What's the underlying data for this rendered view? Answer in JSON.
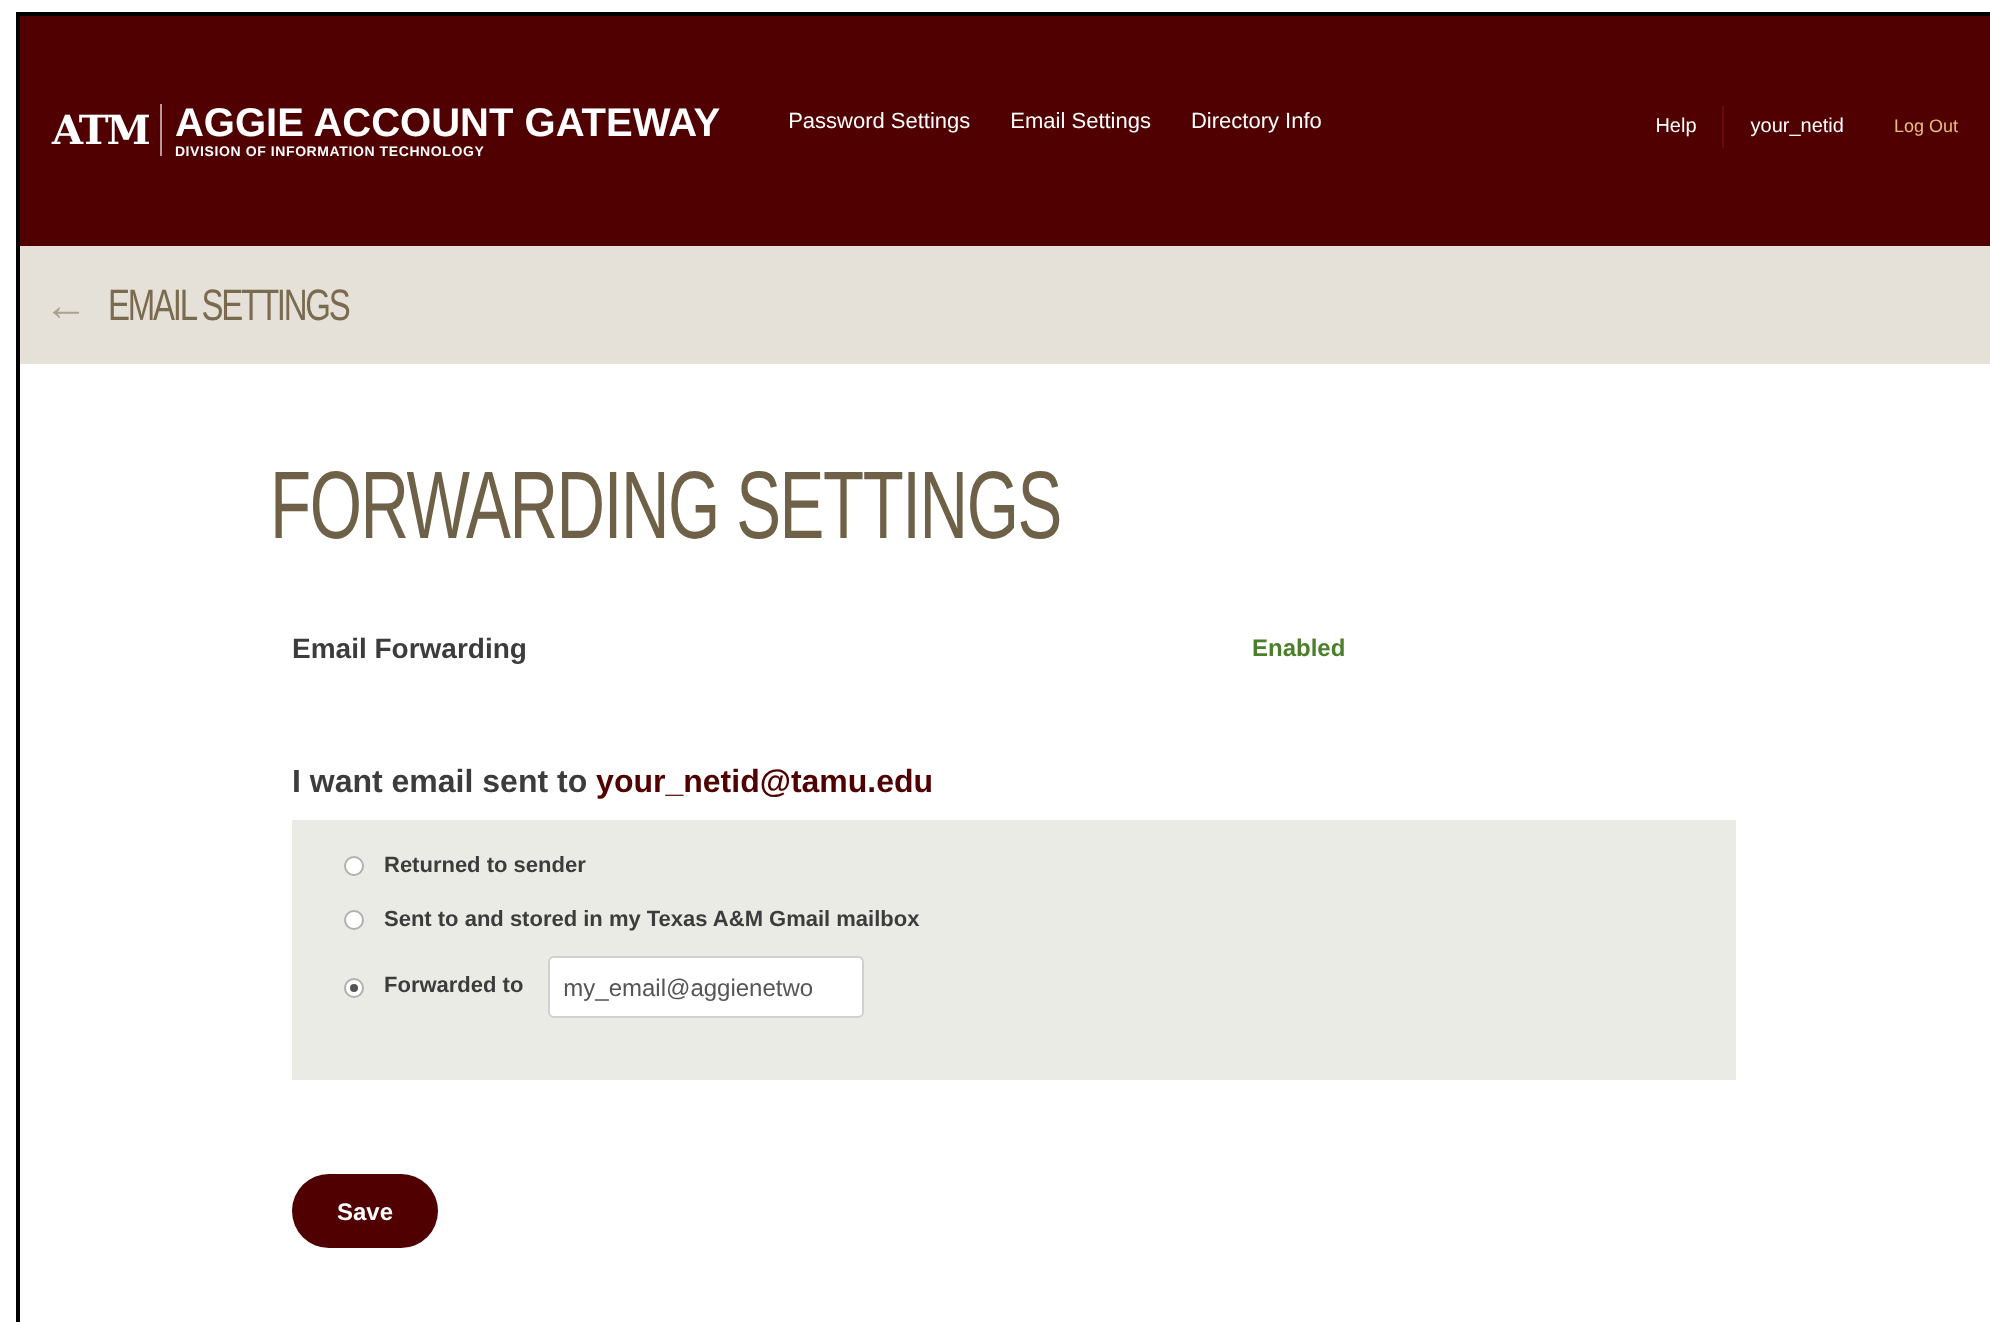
{
  "header": {
    "logo_letters": "ATM",
    "title": "AGGIE ACCOUNT GATEWAY",
    "subtitle": "DIVISION OF INFORMATION TECHNOLOGY",
    "nav": [
      {
        "label": "Password Settings"
      },
      {
        "label": "Email Settings"
      },
      {
        "label": "Directory Info"
      }
    ],
    "right_links": [
      {
        "label": "Help",
        "kind": "plain"
      },
      {
        "label": "your_netid",
        "kind": "plain"
      },
      {
        "label": "Log Out",
        "kind": "logout"
      }
    ]
  },
  "breadcrumb": {
    "back_arrow": "←",
    "label": "EMAIL SETTINGS"
  },
  "page_title": "FORWARDING SETTINGS",
  "status": {
    "label": "Email Forwarding",
    "value": "Enabled"
  },
  "question": {
    "text": "I want email sent to",
    "address": "your_netid@tamu.edu"
  },
  "options": [
    {
      "label": "Returned to sender",
      "selected": false
    },
    {
      "label": "Sent to and stored in my Texas A&M Gmail mailbox",
      "selected": false
    },
    {
      "label": "Forwarded to",
      "selected": true,
      "value": "my_email@aggienetwo"
    }
  ],
  "save_button": "Save"
}
